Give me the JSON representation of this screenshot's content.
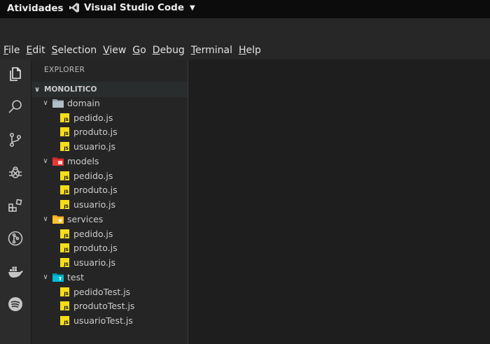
{
  "topbar": {
    "activities": "Atividades",
    "app_name": "Visual Studio Code"
  },
  "menu": [
    {
      "label": "File",
      "u": "F",
      "rest": "ile"
    },
    {
      "label": "Edit",
      "u": "E",
      "rest": "dit"
    },
    {
      "label": "Selection",
      "u": "S",
      "rest": "election"
    },
    {
      "label": "View",
      "u": "V",
      "rest": "iew"
    },
    {
      "label": "Go",
      "u": "G",
      "rest": "o"
    },
    {
      "label": "Debug",
      "u": "D",
      "rest": "ebug"
    },
    {
      "label": "Terminal",
      "u": "T",
      "rest": "erminal"
    },
    {
      "label": "Help",
      "u": "H",
      "rest": "elp"
    }
  ],
  "activity_icons": [
    "files-icon",
    "search-icon",
    "source-control-icon",
    "debug-icon",
    "extensions-icon",
    "git-graph-icon",
    "docker-icon",
    "spotify-icon"
  ],
  "sidebar": {
    "title": "EXPLORER",
    "section": "MONOLITICO",
    "tree": [
      {
        "type": "folder",
        "label": "domain",
        "icon": "folder-icon"
      },
      {
        "type": "file",
        "label": "pedido.js"
      },
      {
        "type": "file",
        "label": "produto.js"
      },
      {
        "type": "file",
        "label": "usuario.js"
      },
      {
        "type": "folder",
        "label": "models",
        "icon": "folder-models-icon"
      },
      {
        "type": "file",
        "label": "pedido.js"
      },
      {
        "type": "file",
        "label": "produto.js"
      },
      {
        "type": "file",
        "label": "usuario.js"
      },
      {
        "type": "folder",
        "label": "services",
        "icon": "folder-services-icon"
      },
      {
        "type": "file",
        "label": "pedido.js"
      },
      {
        "type": "file",
        "label": "produto.js"
      },
      {
        "type": "file",
        "label": "usuario.js"
      },
      {
        "type": "folder",
        "label": "test",
        "icon": "folder-test-icon"
      },
      {
        "type": "file",
        "label": "pedidoTest.js"
      },
      {
        "type": "file",
        "label": "produtoTest.js"
      },
      {
        "type": "file",
        "label": "usuarioTest.js"
      }
    ]
  },
  "colors": {
    "js_icon": "#f5de19",
    "folder": "#90a4ae",
    "models": "#e53935",
    "services": "#fbc02d",
    "test": "#00bcd4"
  }
}
